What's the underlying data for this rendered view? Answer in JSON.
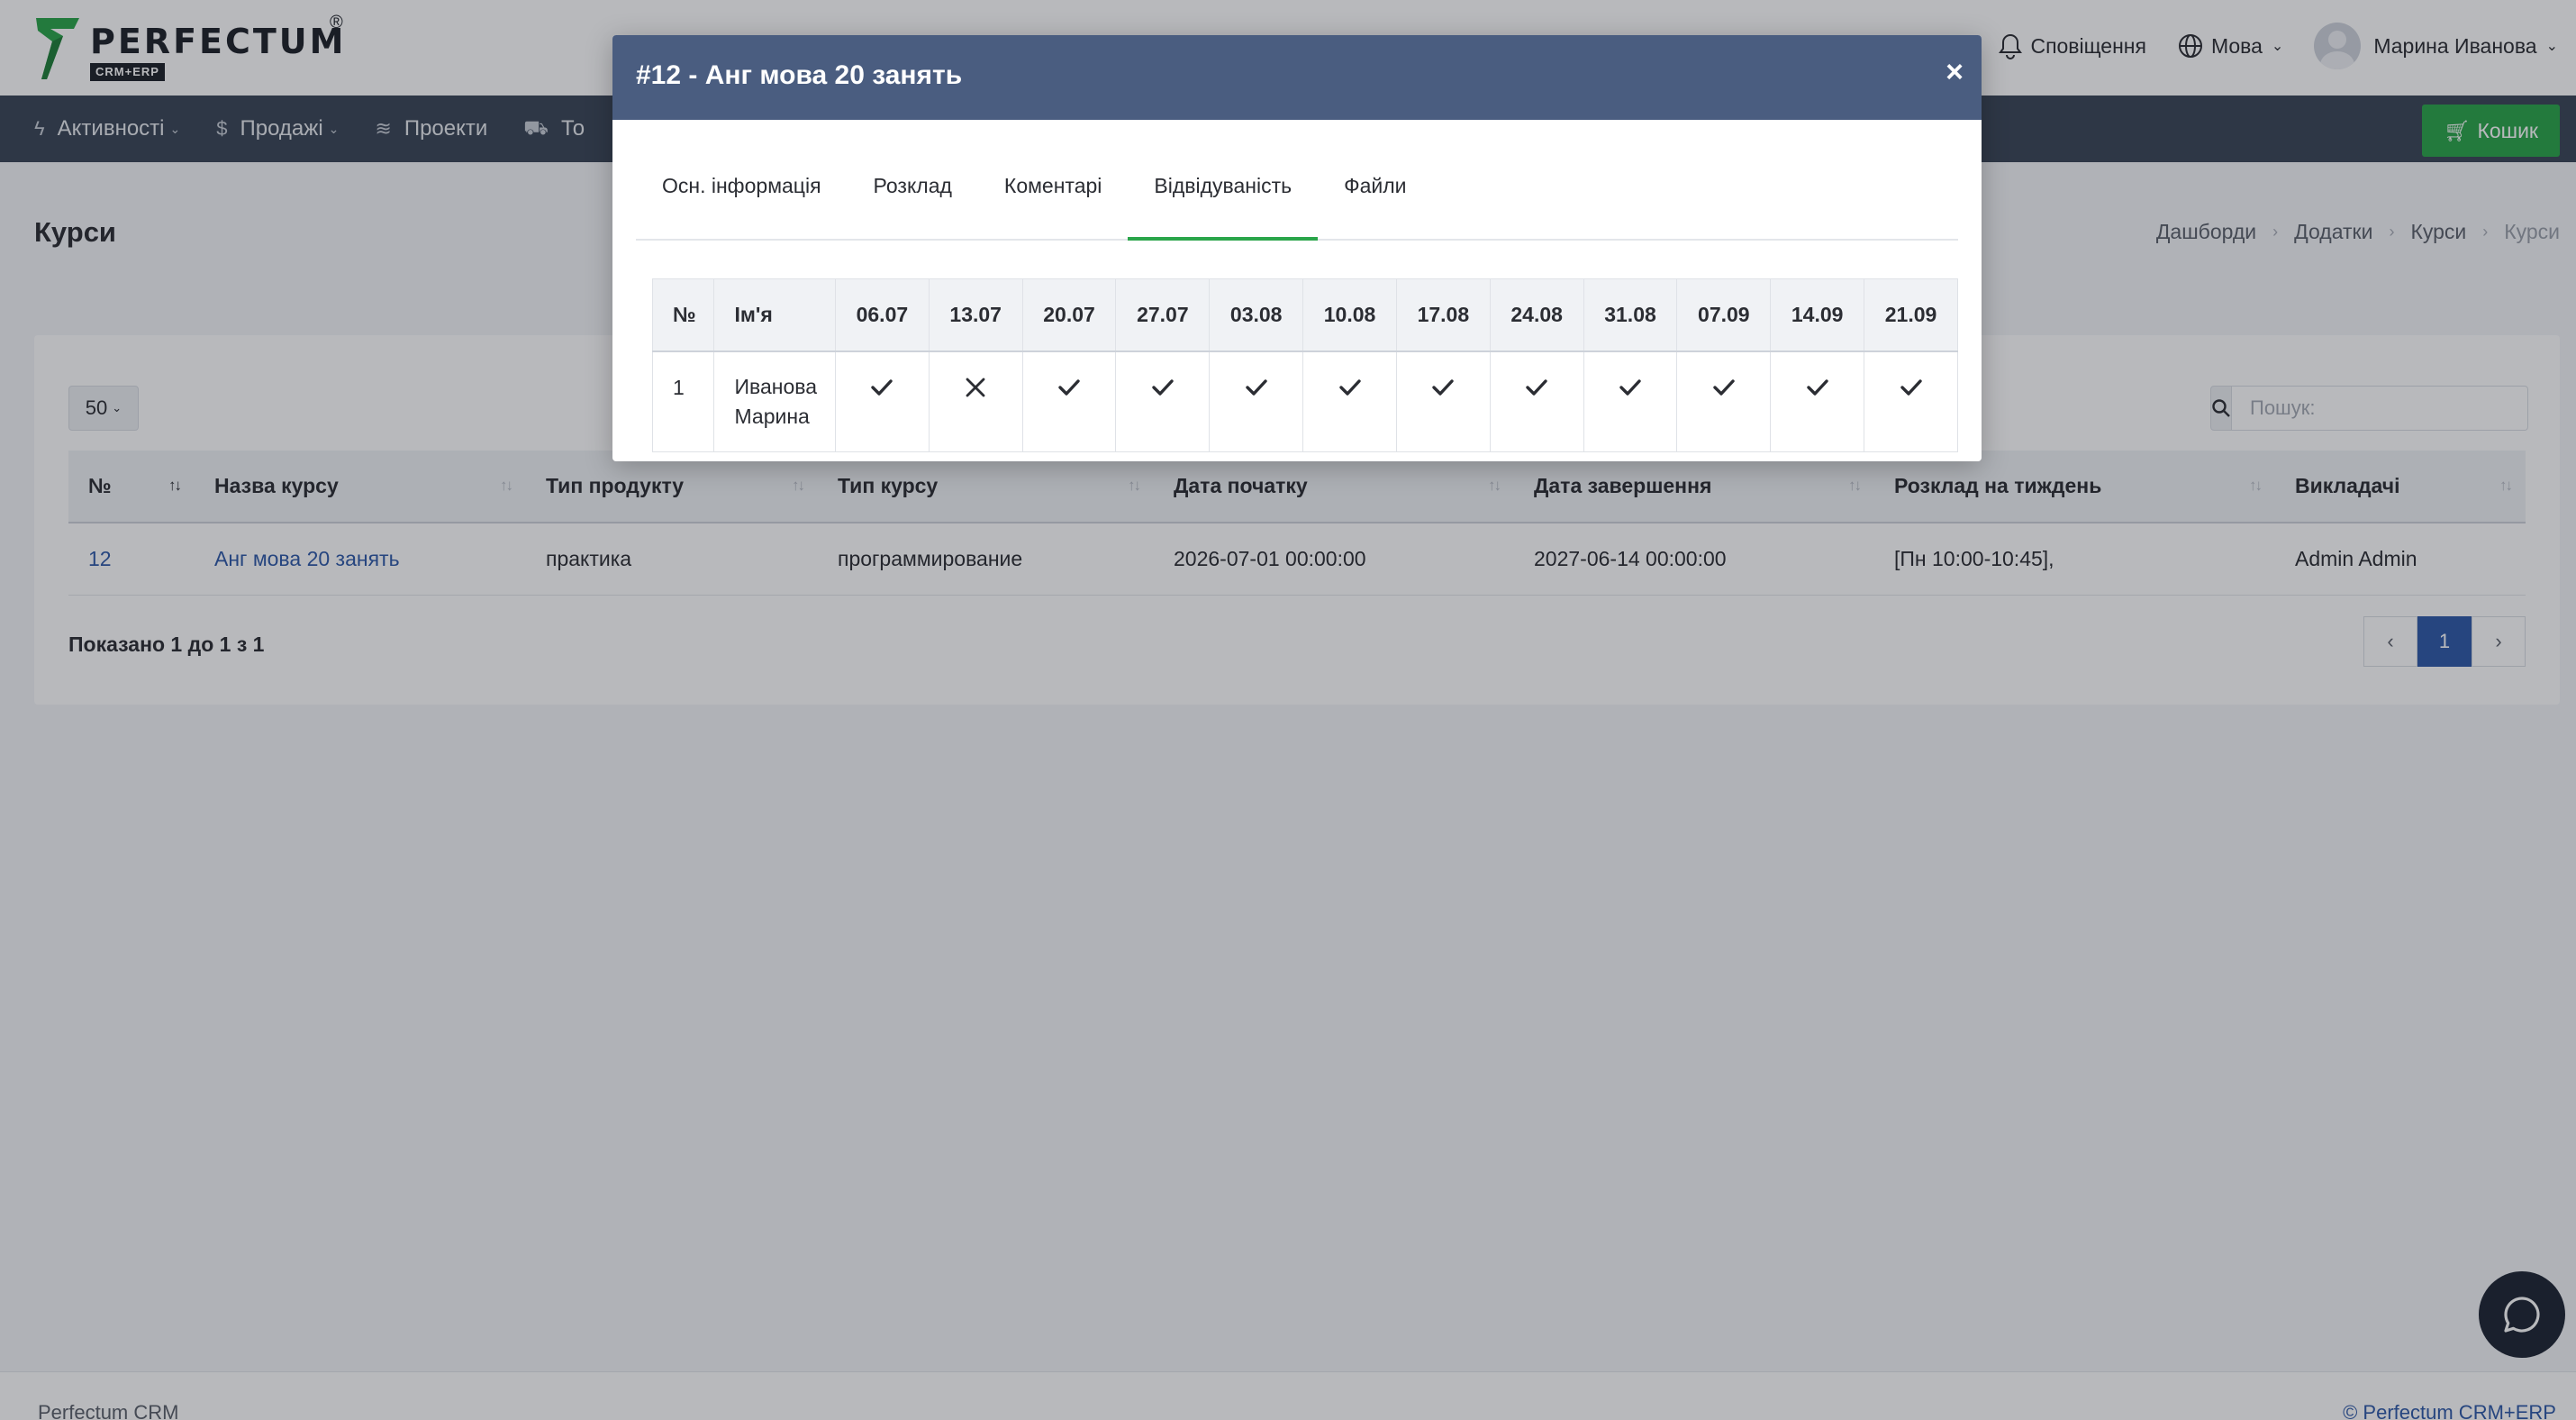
{
  "brand": {
    "name": "PERFECTUM",
    "sub": "CRM+ERP",
    "reg": "®",
    "colors": {
      "accent_green": "#2aa54a",
      "link_blue": "#2f5aa8",
      "nav_bg": "#3a4657",
      "modal_head": "#4a5d80"
    }
  },
  "header": {
    "notifications_label": "Сповіщення",
    "language_label": "Мова",
    "user_name": "Марина Иванова"
  },
  "nav": {
    "items": [
      {
        "label": "Активності",
        "icon": "bolt-icon",
        "dropdown": true
      },
      {
        "label": "Продажі",
        "icon": "dollar-icon",
        "dropdown": true
      },
      {
        "label": "Проекти",
        "icon": "layers-icon",
        "dropdown": false
      },
      {
        "label": "То",
        "icon": "cart-icon",
        "dropdown": false
      }
    ],
    "cart_label": "Кошик"
  },
  "page": {
    "title": "Курси",
    "breadcrumb": [
      "Дашборди",
      "Додатки",
      "Курси",
      "Курси"
    ]
  },
  "table": {
    "length_value": "50",
    "search_placeholder": "Пошук:",
    "columns": [
      "№",
      "Назва курсу",
      "Тип продукту",
      "Тип курсу",
      "Дата початку",
      "Дата завершення",
      "Розклад на тиждень",
      "Викладачі"
    ],
    "rows": [
      [
        "12",
        "Анг мова 20 занять",
        "практика",
        "программирование",
        "2026-07-01 00:00:00",
        "2027-06-14 00:00:00",
        "[Пн 10:00-10:45],",
        "Admin Admin"
      ]
    ],
    "info": "Показано 1 до 1 з 1",
    "pager": {
      "prev": "‹",
      "current": "1",
      "next": "›"
    }
  },
  "footer": {
    "left": "Perfectum CRM",
    "right": "© Perfectum CRM+ERP"
  },
  "modal": {
    "title": "#12 - Анг мова 20 занять",
    "close": "×",
    "tabs": [
      "Осн. інформація",
      "Розклад",
      "Коментарі",
      "Відвідуваність",
      "Файли"
    ],
    "active_tab": "Відвідуваність",
    "attendance": {
      "headers": [
        "№",
        "Ім'я"
      ],
      "dates": [
        "06.07",
        "13.07",
        "20.07",
        "27.07",
        "03.08",
        "10.08",
        "17.08",
        "24.08",
        "31.08",
        "07.09",
        "14.09",
        "21.09"
      ],
      "rows": [
        {
          "num": "1",
          "name_line1": "Иванова",
          "name_line2": "Марина",
          "marks": [
            "present",
            "absent",
            "present",
            "present",
            "present",
            "present",
            "present",
            "present",
            "present",
            "present",
            "present",
            "present"
          ]
        }
      ]
    }
  }
}
